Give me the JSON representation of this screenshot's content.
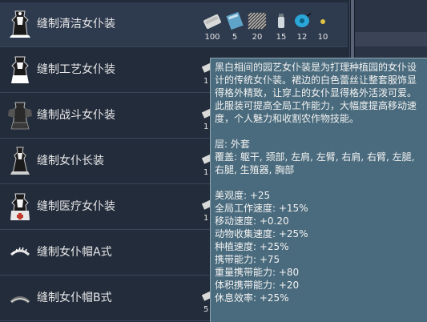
{
  "items": [
    {
      "label": "缝制清洁女仆装",
      "icon": "maid-dress-clean-icon"
    },
    {
      "label": "缝制工艺女仆装",
      "icon": "maid-dress-craft-icon"
    },
    {
      "label": "缝制战斗女仆装",
      "icon": "maid-dress-combat-icon"
    },
    {
      "label": "缝制女仆长装",
      "icon": "maid-dress-head-icon"
    },
    {
      "label": "缝制医疗女仆装",
      "icon": "maid-dress-medical-icon"
    },
    {
      "label": "缝制女仆帽A式",
      "icon": "maid-headband-a-icon"
    },
    {
      "label": "缝制女仆帽B式",
      "icon": "maid-headband-b-icon"
    }
  ],
  "materials": [
    {
      "name": "cloth-icon",
      "count": "100",
      "color": "#d9d9d9"
    },
    {
      "name": "fabric-roll-icon",
      "count": "5",
      "color": "#5fa3c9"
    },
    {
      "name": "checkered-fabric-icon",
      "count": "20",
      "color": "#9a9a9a"
    },
    {
      "name": "bottle-icon",
      "count": "15",
      "color": "#cfd8dc"
    },
    {
      "name": "thread-spool-icon",
      "count": "12",
      "color": "#2aa7d8"
    },
    {
      "name": "button-icon",
      "count": "10",
      "color": "#e0c441"
    }
  ],
  "partial_counts": [
    "1",
    "1",
    "1",
    "1",
    "5"
  ],
  "tooltip": {
    "description": "黑白相间的园艺女仆装是为打理种植园的女仆设计的传统女仆装。裙边的白色蕾丝让整套服饰显得格外精致，让穿上的女仆显得格外活泼可爱。此服装可提高全局工作能力，大幅度提高移动速度，个人魅力和收割农作物技能。",
    "layer": "层: 外套",
    "cover": "覆盖: 躯干, 颈部, 左肩, 左臂, 右肩, 右臂, 左腿, 右腿, 生殖器, 胸部",
    "stats": [
      "美观度: +25",
      "全局工作速度: +15%",
      "移动速度: +0.20",
      "动物收集速度: +25%",
      "种植速度: +25%",
      "携带能力: +75",
      "重量携带能力: +80",
      "体积携带能力: +20",
      "休息效率: +25%"
    ]
  }
}
